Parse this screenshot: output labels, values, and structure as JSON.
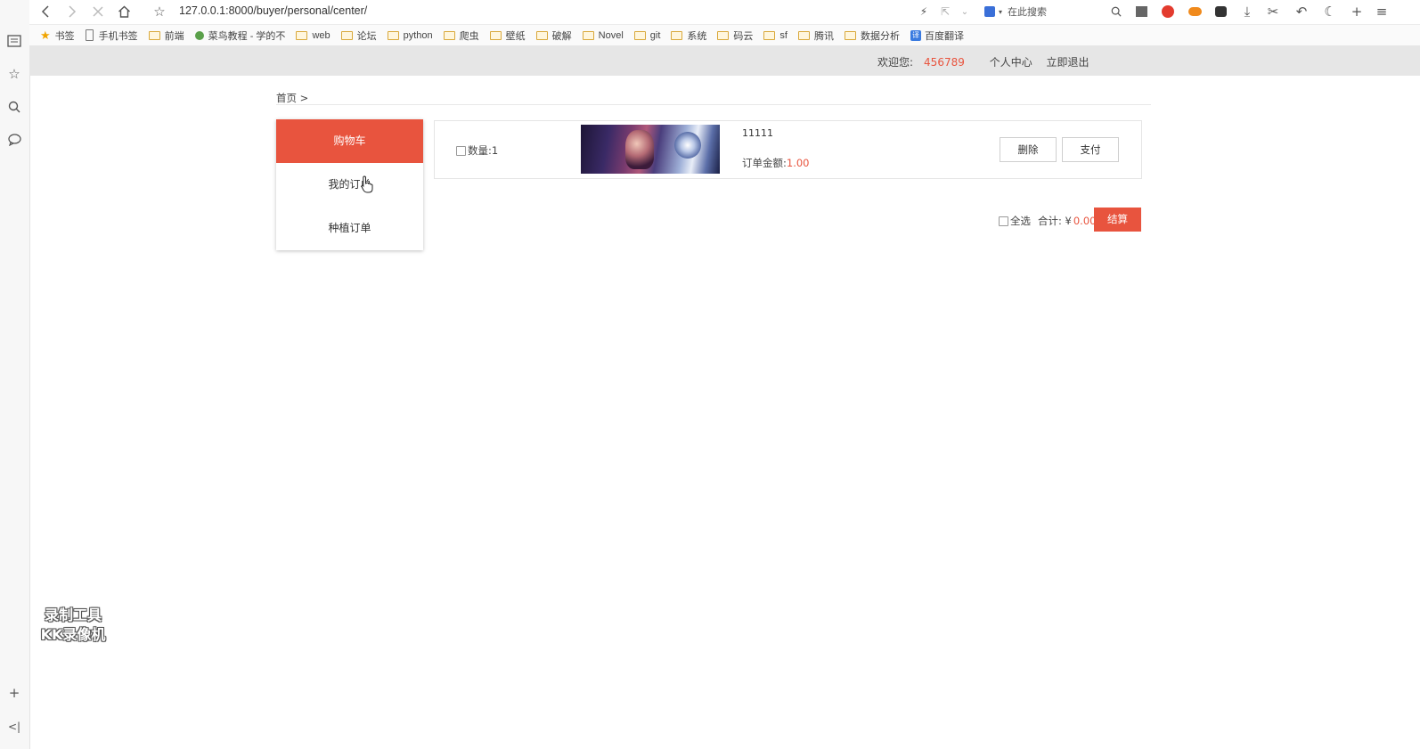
{
  "browser": {
    "url": "127.0.0.1:8000/buyer/personal/center/",
    "search_placeholder": "在此搜索",
    "bookmarks": [
      {
        "label": "书签",
        "icon": "star-icon"
      },
      {
        "label": "手机书签",
        "icon": "phone-icon"
      },
      {
        "label": "前端",
        "icon": "folder-icon"
      },
      {
        "label": "菜鸟教程 - 学的不",
        "icon": "runoob-icon"
      },
      {
        "label": "web",
        "icon": "folder-icon"
      },
      {
        "label": "论坛",
        "icon": "folder-icon"
      },
      {
        "label": "python",
        "icon": "folder-icon"
      },
      {
        "label": "爬虫",
        "icon": "folder-icon"
      },
      {
        "label": "壁纸",
        "icon": "folder-icon"
      },
      {
        "label": "破解",
        "icon": "folder-icon"
      },
      {
        "label": "Novel",
        "icon": "folder-icon"
      },
      {
        "label": "git",
        "icon": "folder-icon"
      },
      {
        "label": "系统",
        "icon": "folder-icon"
      },
      {
        "label": "码云",
        "icon": "folder-icon"
      },
      {
        "label": "sf",
        "icon": "folder-icon"
      },
      {
        "label": "腾讯",
        "icon": "folder-icon"
      },
      {
        "label": "数据分析",
        "icon": "folder-icon"
      },
      {
        "label": "百度翻译",
        "icon": "translate-icon"
      }
    ]
  },
  "header": {
    "welcome": "欢迎您:",
    "user_id": "456789",
    "personal_center": "个人中心",
    "logout": "立即退出"
  },
  "breadcrumb": "首页 >",
  "menu": {
    "items": [
      {
        "label": "购物车",
        "active": true
      },
      {
        "label": "我的订单",
        "active": false
      },
      {
        "label": "种植订单",
        "active": false
      }
    ]
  },
  "cart": {
    "items": [
      {
        "quantity_label": "数量:1",
        "product_name": "11111",
        "amount_label": "订单金额:",
        "amount_value": "1.00",
        "delete_label": "删除",
        "pay_label": "支付"
      }
    ],
    "select_all_label": "全选",
    "total_label": "合计: ¥",
    "total_value": "0.00",
    "checkout_label": "结算"
  },
  "watermark": {
    "line1": "录制工具",
    "line2": "KK录像机"
  },
  "colors": {
    "accent": "#e8543e",
    "header_bg": "#e6e6e6"
  }
}
